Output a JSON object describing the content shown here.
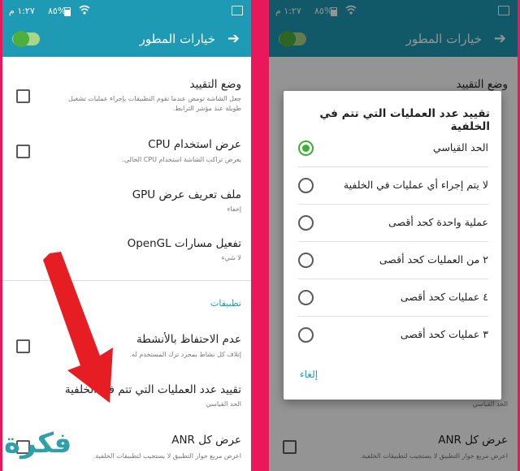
{
  "colors": {
    "accent": "#1e9ab5",
    "divider_bg": "#e8185a",
    "switch_on": "#4caf3e",
    "radio_selected": "#3fae36",
    "arrow": "#e61e23",
    "watermark": "#2ea0aa"
  },
  "status_bar": {
    "time": "١:٢٧ م",
    "battery": "٨٥%",
    "icons": [
      "battery-icon",
      "wifi-icon",
      "gallery-icon"
    ]
  },
  "toolbar": {
    "title": "خيارات المطور",
    "back_icon": "arrow-right-icon",
    "switch_on": true
  },
  "left_screen": {
    "items": [
      {
        "title": "وضع التقييد",
        "subtitle": "جعل الشاشة تومض عندما تقوم التطبيقات بإجراء عمليات تشغيل طويلة عند مؤشر الترابط.",
        "checkbox": true
      },
      {
        "title": "عرض استخدام CPU",
        "subtitle": "يعرض تراكب الشاشة استخدام CPU الحالي.",
        "checkbox": true
      },
      {
        "title": "ملف تعريف عرض GPU",
        "subtitle": "إخفاء",
        "checkbox": false
      },
      {
        "title": "تفعيل مسارات OpenGL",
        "subtitle": "لا شيء",
        "checkbox": false
      }
    ],
    "section_header": "تطبيقات",
    "app_items": [
      {
        "title": "عدم الاحتفاظ بالأنشطة",
        "subtitle": "إتلاف كل نشاط بمجرد ترك المستخدم له.",
        "checkbox": true
      },
      {
        "title": "تقييد عدد العمليات التي تتم في الخلفية",
        "subtitle": "الحد القياسي",
        "checkbox": false
      },
      {
        "title": "عرض كل ANR",
        "subtitle": "اعرض مربع حوار التطبيق لا يستجيب لتطبيقات الخلفية.",
        "checkbox": true
      }
    ]
  },
  "right_screen": {
    "background_items": [
      {
        "title": "وضع التقييد"
      },
      {
        "title": "الحد القياسي"
      },
      {
        "title": "عرض كل ANR",
        "subtitle": "اعرض مربع حوار التطبيق لا يستجيب لتطبيقات الخلفية."
      }
    ],
    "dialog": {
      "title": "تقييد عدد العمليات التي تتم في الخلفية",
      "options": [
        {
          "label": "الحد القياسي",
          "selected": true
        },
        {
          "label": "لا يتم إجراء أي عمليات في الخلفية",
          "selected": false
        },
        {
          "label": "عملية واحدة كحد أقصى",
          "selected": false
        },
        {
          "label": "٢ من العمليات كحد أقصى",
          "selected": false
        },
        {
          "label": "٤ عمليات كحد أقصى",
          "selected": false
        },
        {
          "label": "٣ عمليات كحد أقصى",
          "selected": false
        }
      ],
      "cancel_label": "إلغاء"
    }
  },
  "watermark": {
    "text": "فكرة"
  }
}
